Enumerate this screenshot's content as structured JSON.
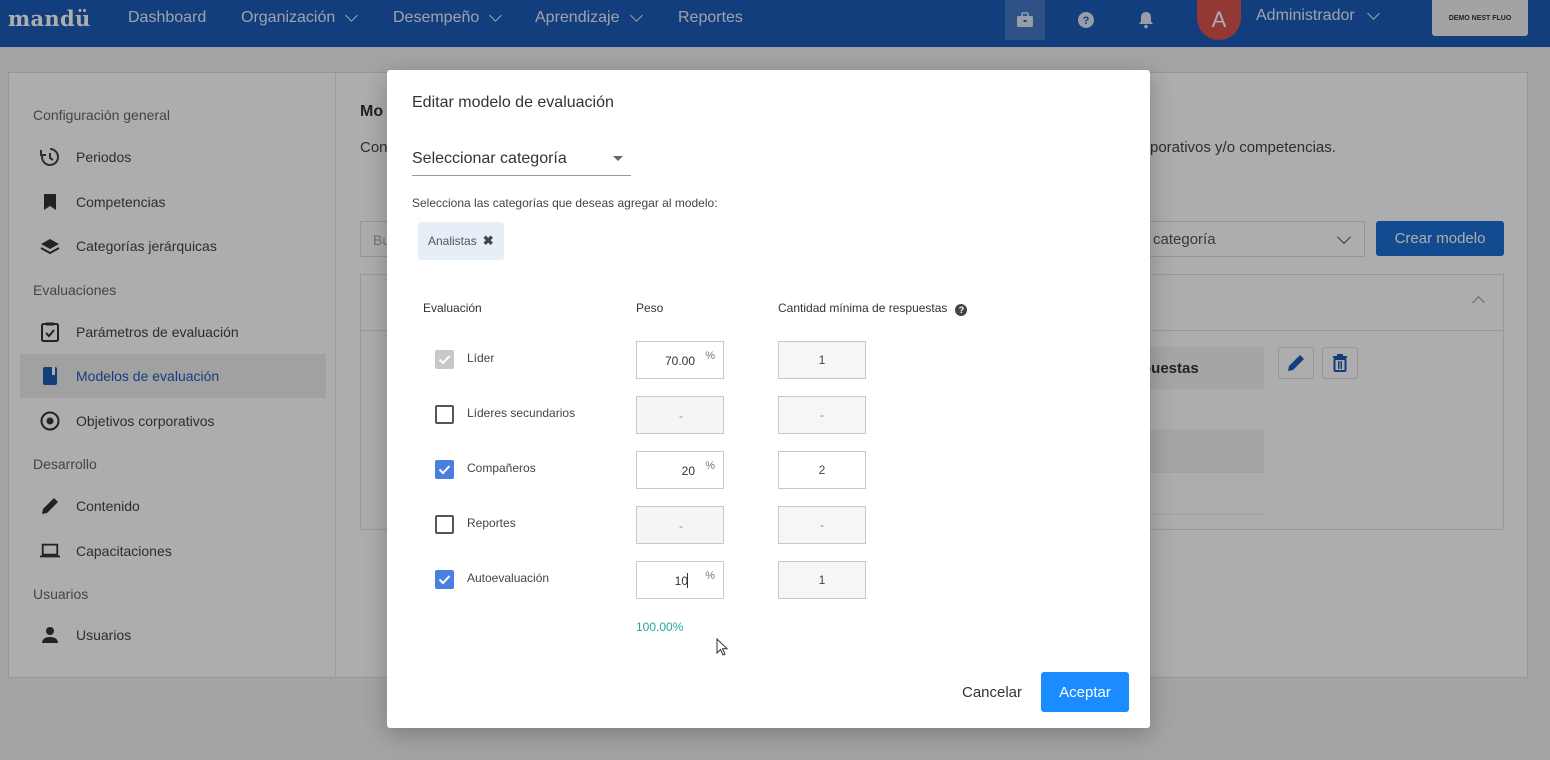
{
  "nav": {
    "logo": "mandü",
    "items": [
      {
        "label": "Dashboard"
      },
      {
        "label": "Organización"
      },
      {
        "label": "Desempeño"
      },
      {
        "label": "Aprendizaje"
      },
      {
        "label": "Reportes"
      }
    ],
    "avatar_letter": "A",
    "user_name": "Administrador",
    "demo_label": "DEMO NEST FLUO"
  },
  "sidebar": {
    "sections": [
      {
        "title": "Configuración general"
      },
      {
        "title": "Evaluaciones"
      },
      {
        "title": "Desarrollo"
      },
      {
        "title": "Usuarios"
      }
    ],
    "items": [
      {
        "label": "Periodos",
        "icon": "history-icon"
      },
      {
        "label": "Competencias",
        "icon": "bookmark-icon"
      },
      {
        "label": "Categorías jerárquicas",
        "icon": "layers-icon"
      },
      {
        "label": "Parámetros de evaluación",
        "icon": "clipboard-check-icon"
      },
      {
        "label": "Modelos de evaluación",
        "icon": "book-icon"
      },
      {
        "label": "Objetivos corporativos",
        "icon": "target-icon"
      },
      {
        "label": "Contenido",
        "icon": "pencil-icon"
      },
      {
        "label": "Capacitaciones",
        "icon": "laptop-icon"
      },
      {
        "label": "Usuarios",
        "icon": "user-icon"
      }
    ]
  },
  "background": {
    "title_fragment": "Mo",
    "desc_fragment_left": "Con",
    "desc_fragment_right": "porativos y/o competencias.",
    "search_fragment": "Bu",
    "select_fragment": "categoría",
    "create_button": "Crear modelo",
    "table_header_fragment": "puestas"
  },
  "modal": {
    "title": "Editar modelo de evaluación",
    "category_select": "Seleccionar categoría",
    "hint": "Selecciona las categorías que deseas agregar al modelo:",
    "chip": "Analistas",
    "columns": {
      "evaluation": "Evaluación",
      "weight": "Peso",
      "min_responses": "Cantidad mínima de respuestas"
    },
    "rows": [
      {
        "label": "Líder",
        "state": "checked-disabled",
        "weight": "70.00",
        "min": "1"
      },
      {
        "label": "Líderes secundarios",
        "state": "unchecked",
        "weight": "-",
        "min": "-"
      },
      {
        "label": "Compañeros",
        "state": "checked",
        "weight": "20",
        "min": "2"
      },
      {
        "label": "Reportes",
        "state": "unchecked",
        "weight": "-",
        "min": "-"
      },
      {
        "label": "Autoevaluación",
        "state": "checked",
        "weight": "10",
        "min": "1"
      }
    ],
    "pct_symbol": "%",
    "total": "100.00%",
    "cancel": "Cancelar",
    "accept": "Aceptar"
  },
  "colors": {
    "nav_bg": "#1d5cb8",
    "primary": "#1a8cff",
    "checkbox": "#4a7fe0",
    "total": "#26a69a"
  }
}
